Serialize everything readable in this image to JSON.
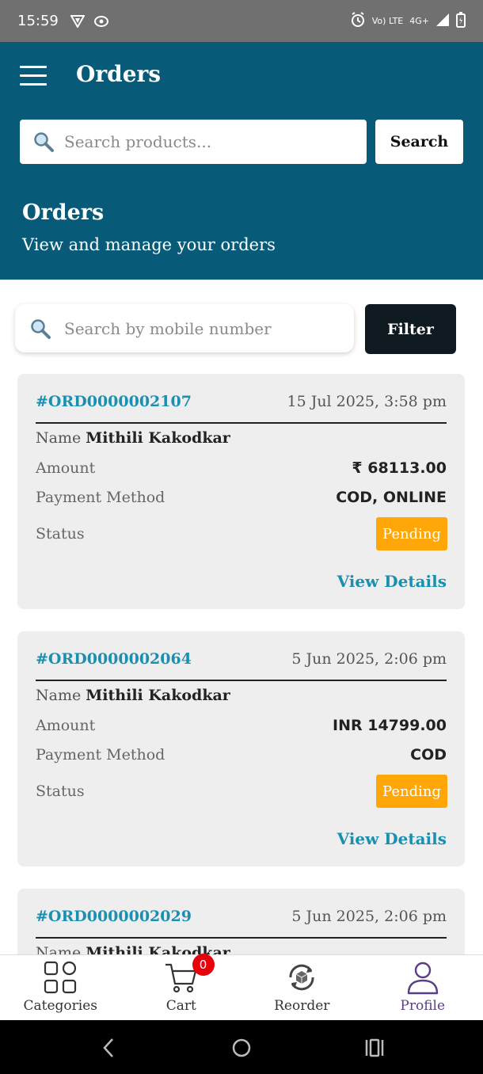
{
  "status_bar": {
    "time": "15:59",
    "network_label": "Vo) LTE",
    "signal_label": "4G+"
  },
  "appbar": {
    "title": "Orders",
    "search_placeholder": "Search products...",
    "search_button": "Search",
    "heading": "Orders",
    "subheading": "View and manage your orders"
  },
  "toolbar": {
    "mobile_search_placeholder": "Search by mobile number",
    "filter_button": "Filter"
  },
  "labels": {
    "name": "Name",
    "amount": "Amount",
    "payment_method": "Payment Method",
    "status": "Status",
    "view_details": "View Details"
  },
  "orders": [
    {
      "id": "#ORD0000002107",
      "date": "15 Jul 2025, 3:58 pm",
      "customer": "Mithili Kakodkar",
      "amount": "₹ 68113.00",
      "payment_method": "COD, ONLINE",
      "status": "Pending"
    },
    {
      "id": "#ORD0000002064",
      "date": "5 Jun 2025, 2:06 pm",
      "customer": "Mithili Kakodkar",
      "amount": "INR 14799.00",
      "payment_method": "COD",
      "status": "Pending"
    },
    {
      "id": "#ORD0000002029",
      "date": "5 Jun 2025, 2:06 pm",
      "customer": "Mithili Kakodkar"
    }
  ],
  "bottom_nav": {
    "items": [
      {
        "label": "Categories",
        "icon": "grid-icon"
      },
      {
        "label": "Cart",
        "icon": "cart-icon",
        "badge": "0"
      },
      {
        "label": "Reorder",
        "icon": "reorder-icon"
      },
      {
        "label": "Profile",
        "icon": "profile-icon",
        "active": true
      }
    ]
  },
  "colors": {
    "primary": "#075a78",
    "accent_link": "#1a8fb0",
    "pending": "#ffa709",
    "filter_button": "#0e1a1f",
    "badge": "#e8000b",
    "active_nav": "#5a3f86"
  }
}
